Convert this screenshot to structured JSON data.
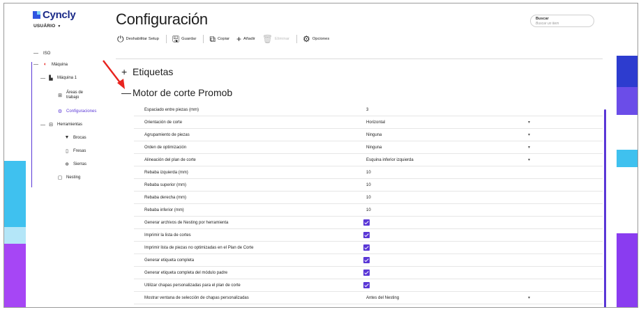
{
  "app": {
    "logo": "Cyncly",
    "user": "USUÁRIO",
    "title": "Configuración"
  },
  "search": {
    "label": "Buscar",
    "placeholder": "Buscar un item"
  },
  "toolbar": {
    "disable_setup": "Deshabilitar Setup",
    "save": "Guardar",
    "copy": "Copiar",
    "add": "Añadir",
    "delete": "Eliminar",
    "options": "Opciones"
  },
  "sidebar": {
    "iso": "ISO",
    "machine": "Máquina",
    "machine1": "Máquina 1",
    "work_areas": "Áreas de trabajo",
    "configurations": "Configuraciones",
    "tools": "Herramientas",
    "drills": "Brocas",
    "mills": "Fresas",
    "saws": "Sierras",
    "nesting": "Nesting"
  },
  "sections": {
    "labels": "Etiquetas",
    "engine": "Motor de corte Promob"
  },
  "rows": [
    {
      "label": "Espaciado entre piezas (mm)",
      "value": "3"
    },
    {
      "label": "Orientación de corte",
      "value": "Horizontal"
    },
    {
      "label": "Agrupamiento de piezas",
      "value": "Ninguna"
    },
    {
      "label": "Orden de optimización",
      "value": "Ninguna"
    },
    {
      "label": "Alineación del plan de corte",
      "value": "Esquina inferior izquierda"
    },
    {
      "label": "Rebaba izquierda (mm)",
      "value": "10"
    },
    {
      "label": "Rebaba superior (mm)",
      "value": "10"
    },
    {
      "label": "Rebaba derecha (mm)",
      "value": "10"
    },
    {
      "label": "Rebaba inferior (mm)",
      "value": "10"
    },
    {
      "label": "Generar archivos de Nesting por herramienta",
      "checked": true
    },
    {
      "label": "Imprimir la lista de cortes",
      "checked": true
    },
    {
      "label": "Imprimir lista de piezas no optimizadas en el Plan de Corte",
      "checked": true
    },
    {
      "label": "Generar etiqueta completa",
      "checked": true
    },
    {
      "label": "Generar etiqueta completa del módulo padre",
      "checked": true
    },
    {
      "label": "Utilizar chapas personalizadas para el plan de corte",
      "checked": true
    },
    {
      "label": "Mostrar ventana de selección de chapas personalizadas",
      "value": "Antes del Nesting"
    }
  ],
  "colors": {
    "accent": "#5a37d6",
    "arrow": "#e8231e"
  }
}
